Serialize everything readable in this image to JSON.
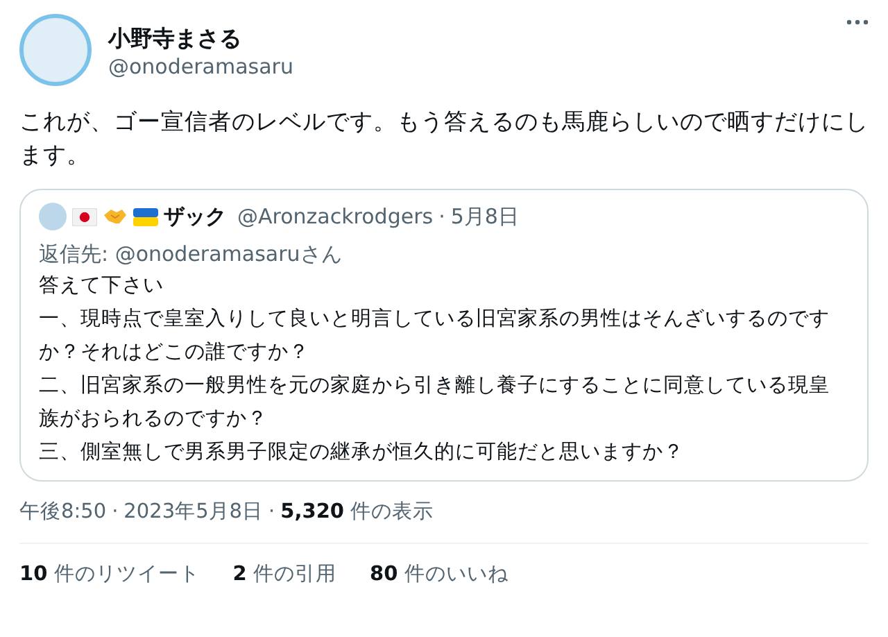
{
  "author": {
    "name": "小野寺まさる",
    "handle": "@onoderamasaru"
  },
  "text": "これが、ゴー宣信者のレベルです。もう答えるのも馬鹿らしいので晒すだけにします。",
  "quote": {
    "name": "ザック",
    "handle": "@Aronzackrodgers",
    "separator": "·",
    "date": "5月8日",
    "reply_to": "返信先: @onoderamasaruさん",
    "lines": [
      "答えて下さい",
      "一、現時点で皇室入りして良いと明言している旧宮家系の男性はそんざいするのですか？それはどこの誰ですか？",
      "二、旧宮家系の一般男性を元の家庭から引き離し養子にすることに同意している現皇族がおられるのですか？",
      "三、側室無しで男系男子限定の継承が恒久的に可能だと思いますか？"
    ]
  },
  "meta": {
    "time": "午後8:50",
    "sep1": "·",
    "date": "2023年5月8日",
    "sep2": "·",
    "views": "**5,320** 件の表示"
  },
  "stats": [
    "**10** 件のリツイート",
    "**2** 件の引用",
    "**80** 件のいいね"
  ]
}
